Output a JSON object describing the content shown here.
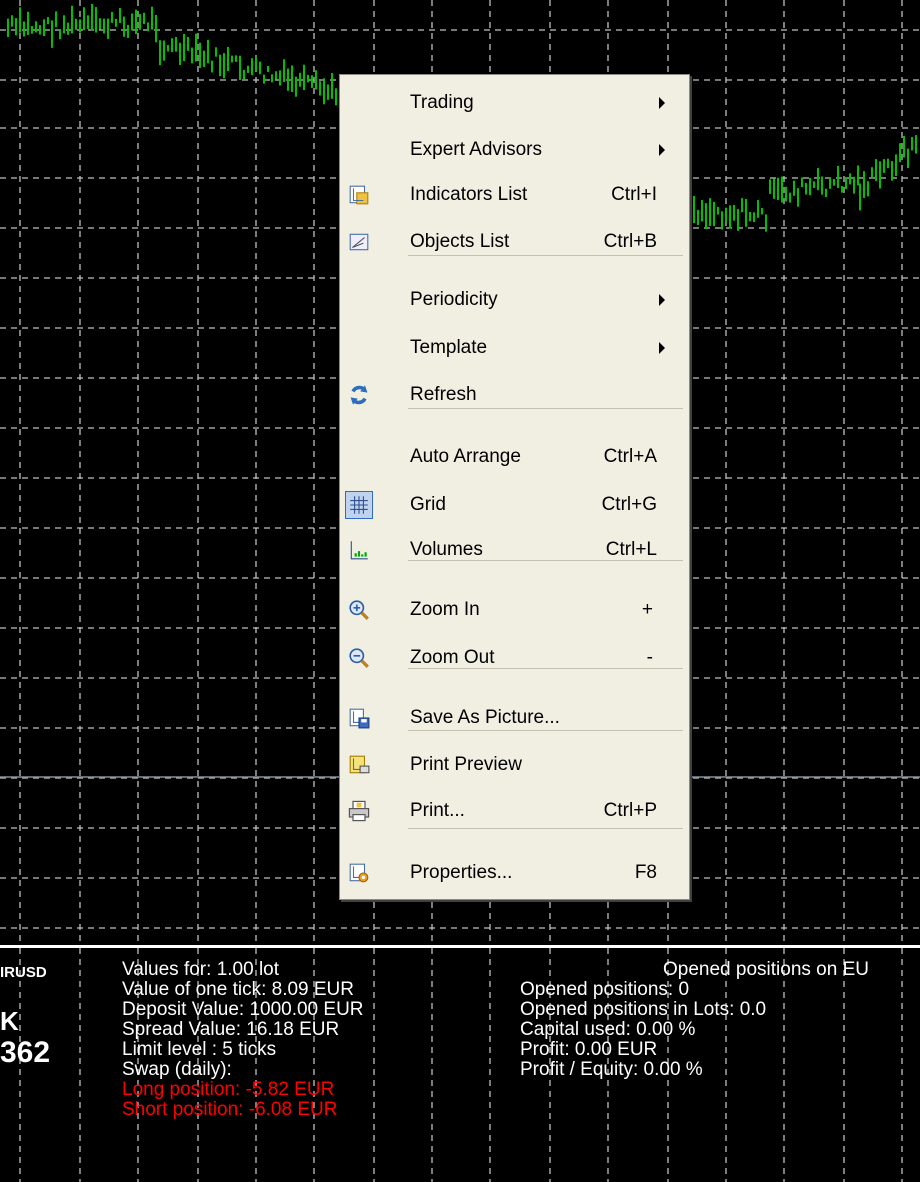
{
  "context_menu": {
    "items": [
      {
        "id": "trading",
        "label": "Trading",
        "shortcut": "",
        "submenu": true,
        "icon": ""
      },
      {
        "id": "expert-advisors",
        "label": "Expert Advisors",
        "shortcut": "",
        "submenu": true,
        "icon": ""
      },
      {
        "id": "indicators-list",
        "label": "Indicators List",
        "shortcut": "Ctrl+I",
        "submenu": false,
        "icon": "indicators-list-icon"
      },
      {
        "id": "objects-list",
        "label": "Objects List",
        "shortcut": "Ctrl+B",
        "submenu": false,
        "icon": "objects-list-icon"
      },
      {
        "id": "periodicity",
        "label": "Periodicity",
        "shortcut": "",
        "submenu": true,
        "icon": ""
      },
      {
        "id": "template",
        "label": "Template",
        "shortcut": "",
        "submenu": true,
        "icon": ""
      },
      {
        "id": "refresh",
        "label": "Refresh",
        "shortcut": "",
        "submenu": false,
        "icon": "refresh-icon"
      },
      {
        "id": "auto-arrange",
        "label": "Auto Arrange",
        "shortcut": "Ctrl+A",
        "submenu": false,
        "icon": ""
      },
      {
        "id": "grid",
        "label": "Grid",
        "shortcut": "Ctrl+G",
        "submenu": false,
        "icon": "grid-icon",
        "checked": true
      },
      {
        "id": "volumes",
        "label": "Volumes",
        "shortcut": "Ctrl+L",
        "submenu": false,
        "icon": "volumes-icon"
      },
      {
        "id": "zoom-in",
        "label": "Zoom In",
        "shortcut": "+",
        "submenu": false,
        "icon": "zoom-in-icon"
      },
      {
        "id": "zoom-out",
        "label": "Zoom Out",
        "shortcut": "-",
        "submenu": false,
        "icon": "zoom-out-icon"
      },
      {
        "id": "save-as-picture",
        "label": "Save As Picture...",
        "shortcut": "",
        "submenu": false,
        "icon": "save-picture-icon"
      },
      {
        "id": "print-preview",
        "label": "Print Preview",
        "shortcut": "",
        "submenu": false,
        "icon": "print-preview-icon"
      },
      {
        "id": "print",
        "label": "Print...",
        "shortcut": "Ctrl+P",
        "submenu": false,
        "icon": "printer-icon"
      },
      {
        "id": "properties",
        "label": "Properties...",
        "shortcut": "F8",
        "submenu": false,
        "icon": "properties-icon"
      }
    ]
  },
  "info_panel": {
    "symbol_partial": "IRUSD",
    "price_letter": "K",
    "price_partial": "362",
    "left_lines": [
      {
        "text": "Values for: 1.00 lot",
        "color": "#ffffff"
      },
      {
        "text": "Value of one tick: 8.09 EUR",
        "color": "#ffffff"
      },
      {
        "text": "Deposit Value: 1000.00 EUR",
        "color": "#ffffff"
      },
      {
        "text": "Spread Value: 16.18 EUR",
        "color": "#ffffff"
      },
      {
        "text": "Limit level : 5  ticks",
        "color": "#ffffff"
      },
      {
        "text": "Swap (daily):",
        "color": "#ffffff"
      },
      {
        "text": "Long position: -5.82 EUR",
        "color": "#ff0000"
      },
      {
        "text": "Short position: -6.08 EUR",
        "color": "#ff0000"
      }
    ],
    "right_header": "Opened positions on EU",
    "right_lines": [
      {
        "text": "Opened positions: 0",
        "color": "#ffffff"
      },
      {
        "text": "Opened positions in Lots: 0.0",
        "color": "#ffffff"
      },
      {
        "text": "Capital used: 0.00 %",
        "color": "#ffffff"
      },
      {
        "text": "Profit: 0.00 EUR",
        "color": "#ffffff"
      },
      {
        "text": "Profit / Equity: 0.00  %",
        "color": "#ffffff"
      }
    ]
  },
  "chart": {
    "background": "#000000",
    "grid_color": "#c0c0c0",
    "bar_color": "#00c000",
    "price_line_color": "#8090a0"
  }
}
